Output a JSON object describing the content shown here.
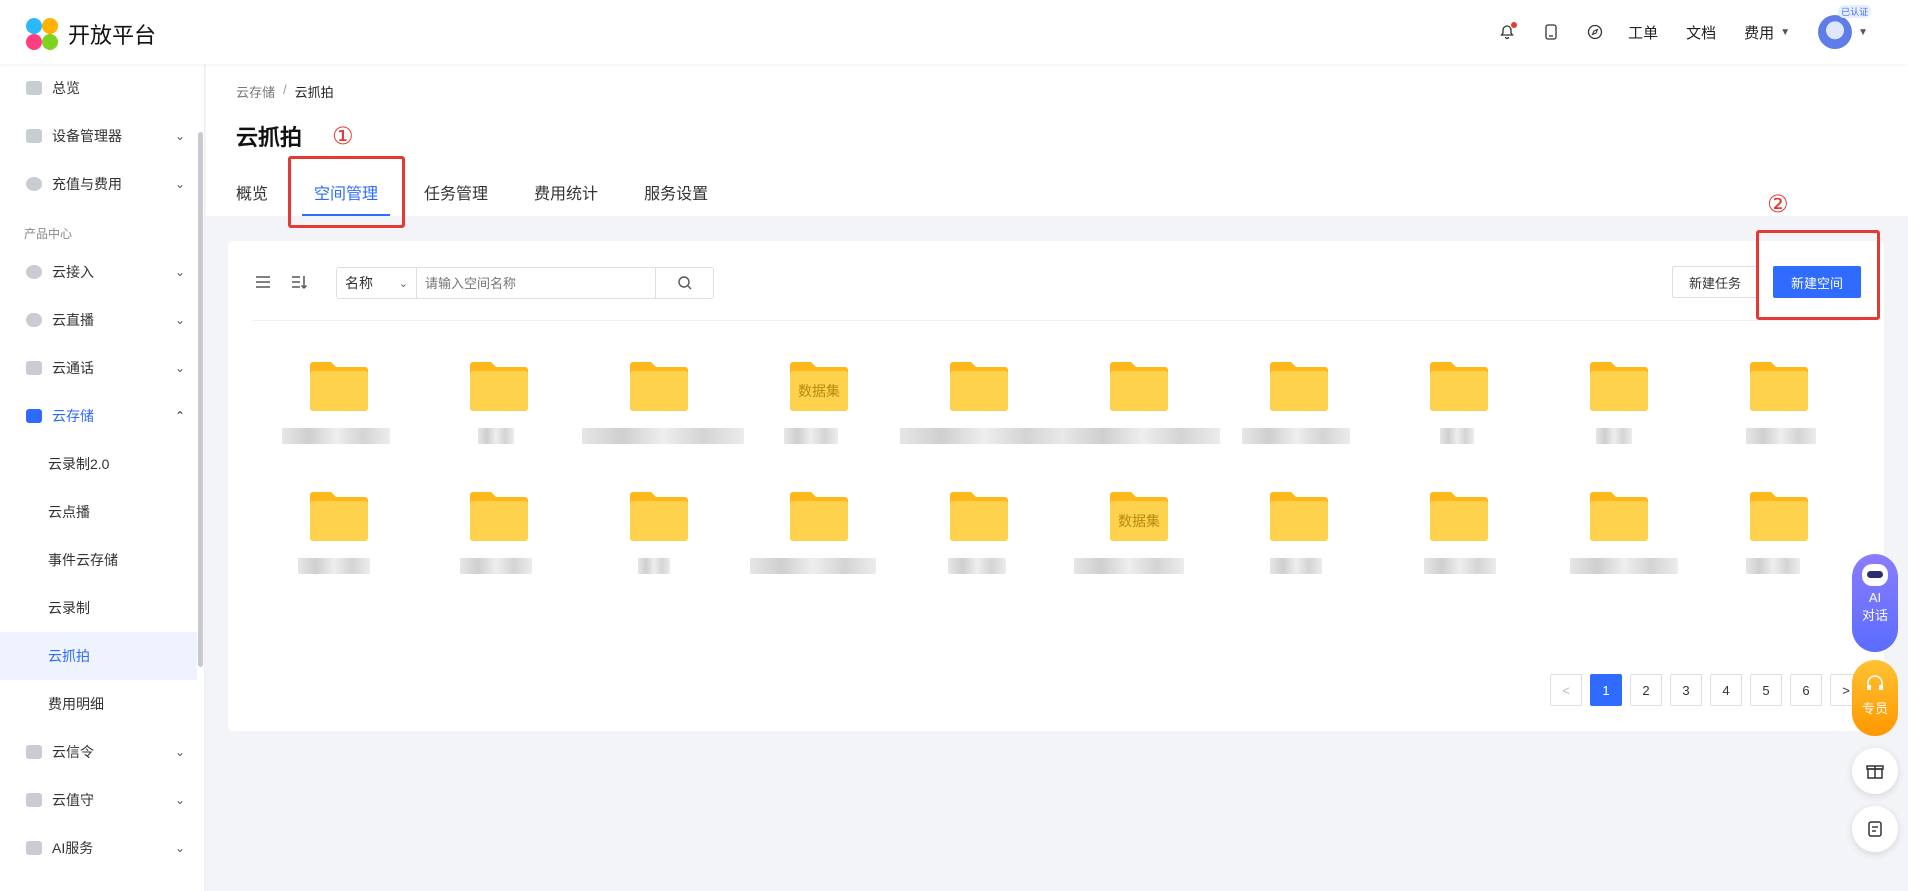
{
  "header": {
    "logo_text": "开放平台",
    "links": {
      "ticket": "工单",
      "docs": "文档",
      "fees": "费用"
    },
    "avatar_badge": "已认证"
  },
  "sidebar": {
    "items": [
      {
        "label": "总览",
        "icon": "home-icon"
      },
      {
        "label": "设备管理器",
        "icon": "device-icon"
      },
      {
        "label": "充值与费用",
        "icon": "yen-icon"
      }
    ],
    "group_label": "产品中心",
    "products": [
      {
        "label": "云接入",
        "icon": "shield-icon"
      },
      {
        "label": "云直播",
        "icon": "cloud-icon"
      },
      {
        "label": "云通话",
        "icon": "phone-icon"
      },
      {
        "label": "云存储",
        "icon": "storage-icon"
      }
    ],
    "sub_items": [
      "云录制2.0",
      "云点播",
      "事件云存储",
      "云录制",
      "云抓拍",
      "费用明细"
    ],
    "more": [
      {
        "label": "云信令",
        "icon": "message-icon"
      },
      {
        "label": "云值守",
        "icon": "guard-icon"
      },
      {
        "label": "AI服务",
        "icon": "ai-icon"
      }
    ]
  },
  "breadcrumb": {
    "parent": "云存储",
    "separator": "/",
    "current": "云抓拍"
  },
  "page_title": "云抓拍",
  "tabs": [
    "概览",
    "空间管理",
    "任务管理",
    "费用统计",
    "服务设置"
  ],
  "annotations": {
    "one": "①",
    "two": "②"
  },
  "toolbar": {
    "select_value": "名称",
    "search_placeholder": "请输入空间名称",
    "new_task": "新建任务",
    "new_space": "新建空间"
  },
  "folders": {
    "dataset_label": "数据集"
  },
  "pagination": {
    "pages": [
      "1",
      "2",
      "3",
      "4",
      "5",
      "6"
    ],
    "current": "1",
    "prev": "<",
    "next": ">"
  },
  "floating": {
    "ai_label_line1": "AI",
    "ai_label_line2": "对话",
    "pro_label": "专员"
  },
  "colors": {
    "primary": "#2f6bff",
    "annotation": "#e53935",
    "folder": "#ffd24d"
  }
}
